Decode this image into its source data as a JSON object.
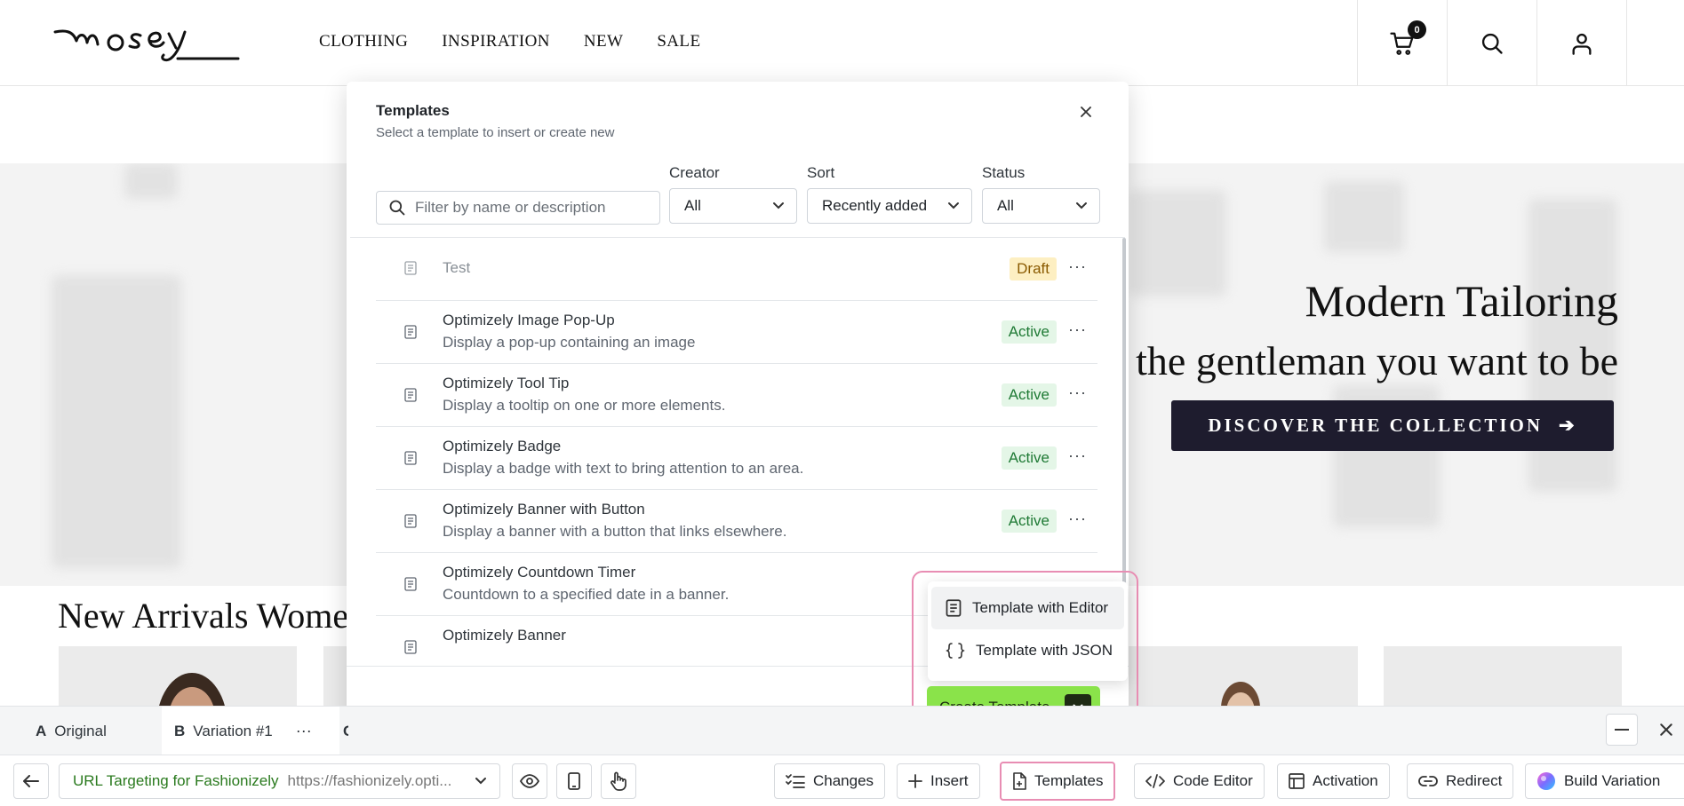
{
  "site": {
    "logo_text": "mosey",
    "nav": [
      "CLOTHING",
      "INSPIRATION",
      "NEW",
      "SALE"
    ],
    "cart_count": "0",
    "hero_title": "Modern Tailoring",
    "hero_subtitle": "the gentleman you want to be",
    "hero_cta": "DISCOVER THE COLLECTION",
    "hero_cta_arrow": "➔",
    "arrivals_title": "New Arrivals Wome"
  },
  "modal": {
    "title": "Templates",
    "subtitle": "Select a template to insert or create new",
    "search_placeholder": "Filter by name or description",
    "filters": {
      "creator": {
        "label": "Creator",
        "value": "All"
      },
      "sort": {
        "label": "Sort",
        "value": "Recently added"
      },
      "status": {
        "label": "Status",
        "value": "All"
      }
    },
    "templates": [
      {
        "name": "Test",
        "description": "",
        "status": "Draft"
      },
      {
        "name": "Optimizely Image Pop-Up",
        "description": "Display a pop-up containing an image",
        "status": "Active"
      },
      {
        "name": "Optimizely Tool Tip",
        "description": "Display a tooltip on one or more elements.",
        "status": "Active"
      },
      {
        "name": "Optimizely Badge",
        "description": "Display a badge with text to bring attention to an area.",
        "status": "Active"
      },
      {
        "name": "Optimizely Banner with Button",
        "description": "Display a banner with a button that links elsewhere.",
        "status": "Active"
      },
      {
        "name": "Optimizely Countdown Timer",
        "description": "Countdown to a specified date in a banner.",
        "status": ""
      },
      {
        "name": "Optimizely Banner",
        "description": "",
        "status": ""
      }
    ],
    "more_label": "···",
    "create_menu": [
      "Template with Editor",
      "Template with JSON"
    ],
    "create_button": "Create Template"
  },
  "variations": {
    "tabs": [
      {
        "letter": "A",
        "label": "Original"
      },
      {
        "letter": "B",
        "label": "Variation #1"
      },
      {
        "letter": "C",
        "label": ""
      }
    ],
    "more_label": "···"
  },
  "toolbar": {
    "url_name": "URL Targeting for Fashionizely",
    "url_value": "https://fashionizely.opti...",
    "buttons": {
      "changes": "Changes",
      "insert": "Insert",
      "templates": "Templates",
      "code_editor": "Code Editor",
      "activation": "Activation",
      "redirect": "Redirect",
      "build_variation": "Build Variation"
    }
  },
  "colors": {
    "accent_green": "#8ae34a",
    "highlight_pink": "#e88db3",
    "hero_cta_bg": "#1e1c2e",
    "active_badge_bg": "#e4f6e7",
    "draft_badge_bg": "#fdefc2"
  },
  "icons": [
    "cart-icon",
    "search-icon",
    "user-icon",
    "close-icon",
    "chevron-down-icon",
    "template-doc-icon",
    "braces-icon",
    "back-arrow-icon",
    "eye-icon",
    "mobile-icon",
    "pointer-hand-icon",
    "changes-list-icon",
    "plus-icon",
    "code-icon",
    "activation-icon",
    "link-icon",
    "sparkle-icon",
    "minimize-icon"
  ]
}
